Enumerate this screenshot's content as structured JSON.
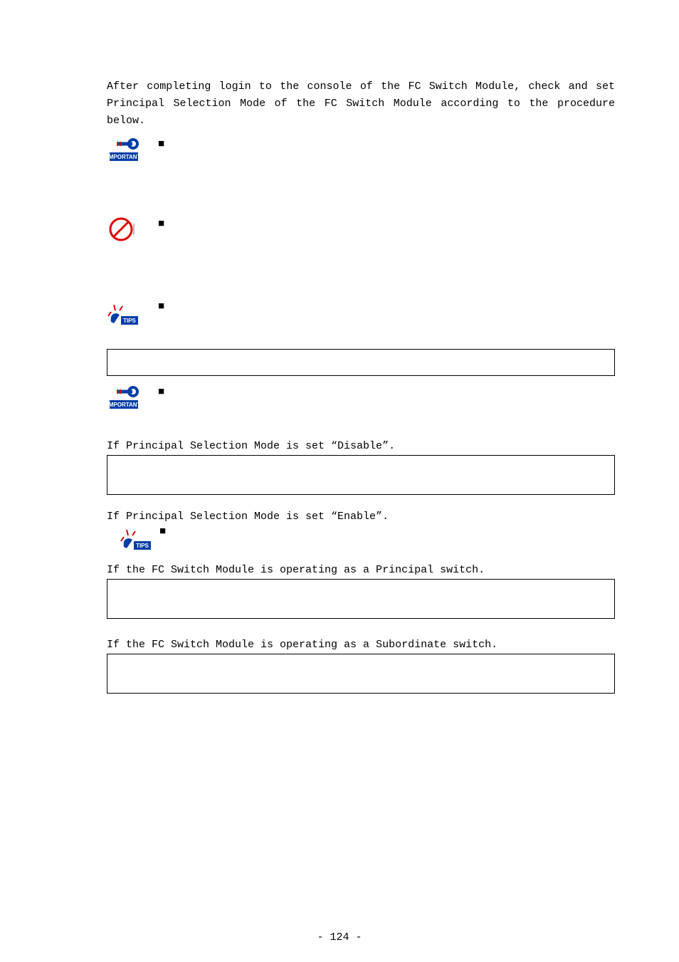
{
  "intro": "After completing login to the console of the FC Switch Module, check and set Principal Selection Mode of the FC Switch Module according to the procedure below.",
  "icons": {
    "important_label": "IMPORTANT",
    "tips_label": "TIPS"
  },
  "bullets": {
    "b1": "■",
    "b2": "■",
    "b3": "■",
    "b4": "■",
    "b5": "■"
  },
  "lines": {
    "disable": "If Principal Selection Mode is set “Disable”.",
    "enable": "If Principal Selection Mode is set “Enable”.",
    "principal": "If the FC Switch Module is operating as a Principal switch.",
    "subordinate": "If the FC Switch Module is operating as a Subordinate switch."
  },
  "footer": "- 124 -"
}
